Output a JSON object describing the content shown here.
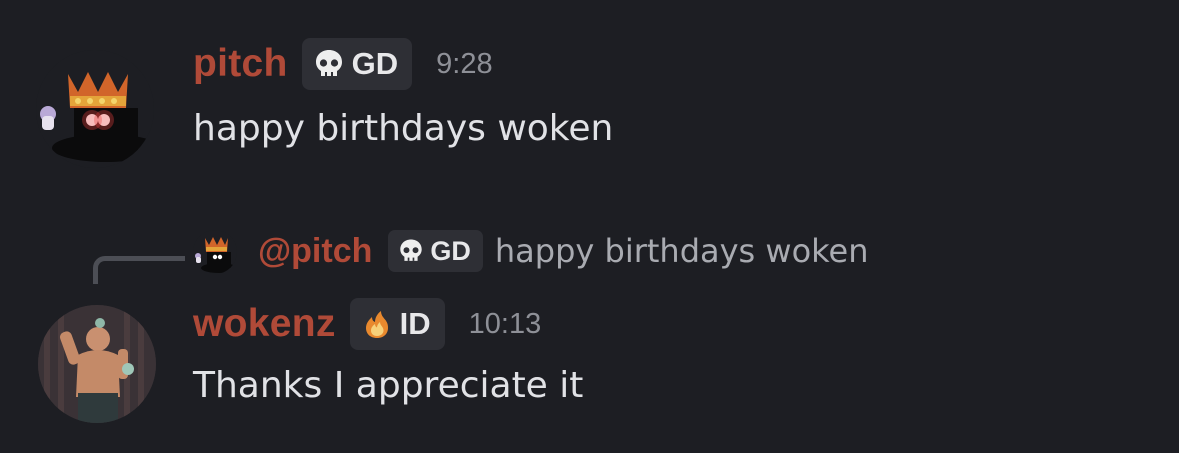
{
  "messages": [
    {
      "username": "pitch",
      "tag": {
        "icon": "skull-icon",
        "label": "GD"
      },
      "timestamp": "9:28",
      "text": "happy birthdays woken"
    },
    {
      "reply_to": {
        "username": "@pitch",
        "tag": {
          "icon": "skull-icon",
          "label": "GD"
        },
        "preview_text": "happy birthdays woken"
      },
      "username": "wokenz",
      "tag": {
        "icon": "flame-icon",
        "label": "ID"
      },
      "timestamp": "10:13",
      "text": "Thanks I appreciate it"
    }
  ],
  "colors": {
    "background": "#1d1e23",
    "username": "#b04a38",
    "tag_background": "#2e2f35",
    "timestamp": "#8e9097",
    "message_text": "#e1e2e6"
  }
}
